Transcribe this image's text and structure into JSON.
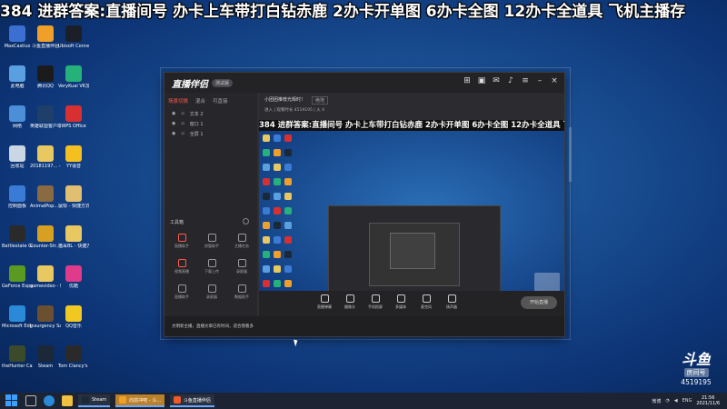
{
  "banner": "384 进群答案:直播间号 办卡上车带打白钻赤鹿 2办卡开单图 6办卡全图 12办卡全道具 飞机主播存",
  "desktop_icons": [
    {
      "label": "MaxCastius",
      "color": "#3b6fd1"
    },
    {
      "label": "斗鱼直播伴侣",
      "color": "#f0a028"
    },
    {
      "label": "Ubisoft Connect",
      "color": "#1b1f2a"
    },
    {
      "label": "此电脑",
      "color": "#5aa0e0"
    },
    {
      "label": "腾讯QQ",
      "color": "#1b1b1b"
    },
    {
      "label": "VeryKuai VK加速器",
      "color": "#26b07a"
    },
    {
      "label": "网络",
      "color": "#4a8fd8"
    },
    {
      "label": "英雄联盟客户端",
      "color": "#1e3f6a"
    },
    {
      "label": "WPS Office",
      "color": "#d83030"
    },
    {
      "label": "回收站",
      "color": "#c9d6e3"
    },
    {
      "label": "20181197... - 快捷方式",
      "color": "#e8c860"
    },
    {
      "label": "YY语音",
      "color": "#f4c020"
    },
    {
      "label": "控制面板",
      "color": "#3a7bd5"
    },
    {
      "label": "AnimalPop... - 快捷方式",
      "color": "#8a6a40"
    },
    {
      "label": "鼠标 - 快捷方式",
      "color": "#e0c070"
    },
    {
      "label": "Battlestate Games L...",
      "color": "#2a2a2a"
    },
    {
      "label": "Counter-Str... Global Off...",
      "color": "#d8a020"
    },
    {
      "label": "猫耳BL - 快捷方式",
      "color": "#e8c860"
    },
    {
      "label": "GeForce Experience",
      "color": "#5a9a20"
    },
    {
      "label": "gamevideo - 快捷方式",
      "color": "#e8c860"
    },
    {
      "label": "优酷",
      "color": "#e03a8a"
    },
    {
      "label": "Microsoft Edge",
      "color": "#2a8ad8"
    },
    {
      "label": "Insurgency Sandstorm",
      "color": "#6a5030"
    },
    {
      "label": "QQ音乐",
      "color": "#f0c820"
    },
    {
      "label": "theHunter Call of t...",
      "color": "#3a4a2a"
    },
    {
      "label": "Steam",
      "color": "#1b2838"
    },
    {
      "label": "Tom Clancy's R...",
      "color": "#2a2a2a"
    }
  ],
  "app": {
    "logo": "直播伴侣",
    "version": "测试版",
    "left_tabs": [
      "场景切换",
      "混合",
      "可直接"
    ],
    "scenes": [
      "文本 2",
      "窗口 1",
      "全屏 1"
    ],
    "tools_header": "工具箱",
    "tools": [
      {
        "label": "直播助手",
        "icon": "record-icon",
        "color": "#ff5a4a"
      },
      {
        "label": "房管助手",
        "icon": "user-icon",
        "color": "#9a9a9a"
      },
      {
        "label": "主播任务",
        "icon": "task-icon",
        "color": "#9a9a9a"
      },
      {
        "label": "视频直播",
        "icon": "video-icon",
        "color": "#ff5a4a"
      },
      {
        "label": "下载上传",
        "icon": "download-icon",
        "color": "#9a9a9a"
      },
      {
        "label": "录屏器",
        "icon": "screen-icon",
        "color": "#9a9a9a"
      },
      {
        "label": "直播助手",
        "icon": "gift-icon",
        "color": "#9a9a9a"
      },
      {
        "label": "录屏器",
        "icon": "capture-icon",
        "color": "#9a9a9a"
      },
      {
        "label": "数据助手",
        "icon": "data-icon",
        "color": "#9a9a9a"
      }
    ],
    "notice": "文明新主播，直播文章已有时间，适合我看多",
    "room": {
      "title": "小团团推荐光辉时！",
      "category": "绝地",
      "stats": "进入 | 观看时长 4519195 | 火 4"
    },
    "controls": [
      {
        "label": "直播弹幕",
        "icon": "screen-icon"
      },
      {
        "label": "摄像头",
        "icon": "camera-icon"
      },
      {
        "label": "手机投屏",
        "icon": "phone-icon"
      },
      {
        "label": "多媒体",
        "icon": "media-icon"
      },
      {
        "label": "麦克风",
        "icon": "mic-icon"
      },
      {
        "label": "扬声器",
        "icon": "speaker-icon"
      }
    ],
    "go_live": "开始直播"
  },
  "watermark": {
    "logo": "斗鱼",
    "sub": "房间号",
    "room": "4519195"
  },
  "taskbar": {
    "tasks": [
      {
        "label": "Steam",
        "color": "#1b2838"
      },
      {
        "label": "向前冲吧 - 斗...",
        "color": "#f0a028"
      },
      {
        "label": "斗鱼直播伴侣",
        "color": "#f05a28"
      }
    ],
    "tray": [
      "微博",
      "ENG"
    ],
    "time": "21:56",
    "date": "2021/11/6"
  }
}
